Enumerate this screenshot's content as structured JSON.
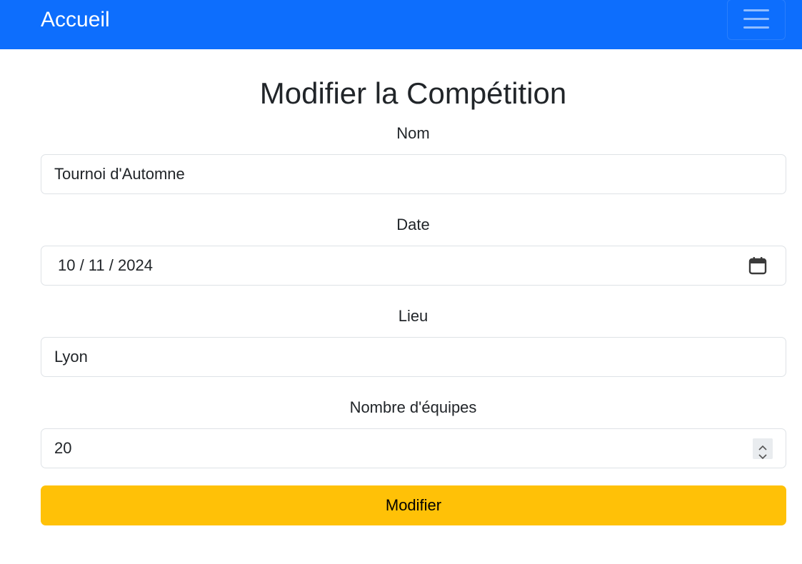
{
  "navbar": {
    "brand": "Accueil",
    "color": "#0d6efd",
    "toggler_icon": "hamburger-icon"
  },
  "page": {
    "title": "Modifier la Compétition"
  },
  "form": {
    "nom": {
      "label": "Nom",
      "value": "Tournoi d'Automne"
    },
    "date": {
      "label": "Date",
      "value": "10 / 11 / 2024",
      "icon": "calendar-icon"
    },
    "lieu": {
      "label": "Lieu",
      "value": "Lyon"
    },
    "nombre_equipes": {
      "label": "Nombre d'équipes",
      "value": "20",
      "icon": "spinner-icon"
    },
    "submit": {
      "label": "Modifier",
      "color": "#ffc107"
    }
  }
}
